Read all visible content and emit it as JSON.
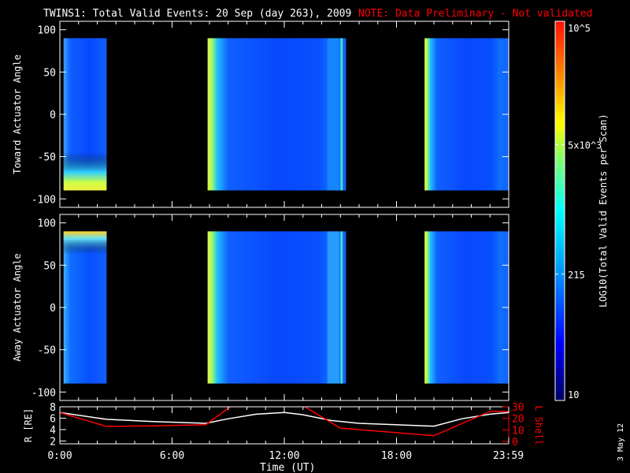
{
  "chart_data": {
    "type": "heatmap",
    "title": "TWINS1: Total Valid Events: 20 Sep (day 263), 2009",
    "note": "NOTE: Data Preliminary - Not validated",
    "xlabel": "Time (UT)",
    "xlim_hours": [
      0,
      24
    ],
    "xticks": [
      {
        "h": 0,
        "label": "0:00"
      },
      {
        "h": 6,
        "label": "6:00"
      },
      {
        "h": 12,
        "label": "12:00"
      },
      {
        "h": 18,
        "label": "18:00"
      },
      {
        "h": 23.98,
        "label": "23:59"
      }
    ],
    "panels": [
      {
        "ylabel": "Toward Actuator Angle",
        "ylim": [
          -110,
          110
        ],
        "yticks": [
          100,
          50,
          0,
          -50,
          -100
        ],
        "data_range": [
          -90,
          90
        ],
        "blocks": [
          {
            "start_h": 0.2,
            "end_h": 2.5,
            "edge": "low-yellow"
          },
          {
            "start_h": 7.9,
            "end_h": 15.3,
            "edge": "left-yellow"
          },
          {
            "start_h": 19.5,
            "end_h": 24,
            "edge": "left-yellow"
          }
        ]
      },
      {
        "ylabel": "Away Actuator Angle",
        "ylim": [
          -110,
          110
        ],
        "yticks": [
          100,
          50,
          0,
          -50,
          -100
        ],
        "data_range": [
          -90,
          90
        ],
        "blocks": [
          {
            "start_h": 0.2,
            "end_h": 2.5,
            "edge": "top-yellow"
          },
          {
            "start_h": 7.9,
            "end_h": 15.3,
            "edge": "left-yellow"
          },
          {
            "start_h": 19.5,
            "end_h": 24,
            "edge": "left-yellow"
          }
        ]
      }
    ],
    "colorbar": {
      "label": "LOG10(Total Valid Events per Scan)",
      "scale": "log",
      "range": [
        10,
        100000
      ],
      "ticks": [
        {
          "value": 100000,
          "label": "10^5"
        },
        {
          "value": 5000,
          "label": "5x10^3"
        },
        {
          "value": 215,
          "label": "215"
        },
        {
          "value": 10,
          "label": "10"
        }
      ]
    },
    "orbit": {
      "left_axis": {
        "label": "R [RE]",
        "ylim": [
          1.5,
          8
        ],
        "yticks": [
          8,
          6,
          4,
          2
        ]
      },
      "right_axis": {
        "label": "L Shell",
        "ylim": [
          0,
          30
        ],
        "yticks": [
          30,
          20,
          10,
          0
        ]
      },
      "series": [
        {
          "name": "R",
          "color": "#ffffff",
          "points": [
            [
              0,
              7.0
            ],
            [
              2.5,
              5.8
            ],
            [
              5,
              5.4
            ],
            [
              7.8,
              5.1
            ],
            [
              9,
              5.9
            ],
            [
              10.5,
              6.7
            ],
            [
              12,
              7.0
            ],
            [
              13,
              6.6
            ],
            [
              14.5,
              5.6
            ],
            [
              16,
              5.1
            ],
            [
              20,
              4.6
            ],
            [
              21.5,
              5.9
            ],
            [
              23,
              6.7
            ],
            [
              24,
              7.0
            ]
          ]
        },
        {
          "name": "L Shell",
          "color": "#ff0000",
          "points": [
            [
              0,
              25
            ],
            [
              2.5,
              13
            ],
            [
              5,
              13.5
            ],
            [
              7.8,
              14.5
            ],
            [
              9.2,
              31
            ],
            [
              13,
              31
            ],
            [
              15,
              11.5
            ],
            [
              20,
              5
            ],
            [
              23,
              26
            ],
            [
              24,
              26
            ]
          ]
        }
      ]
    },
    "date_stamp": "3 May 12"
  }
}
